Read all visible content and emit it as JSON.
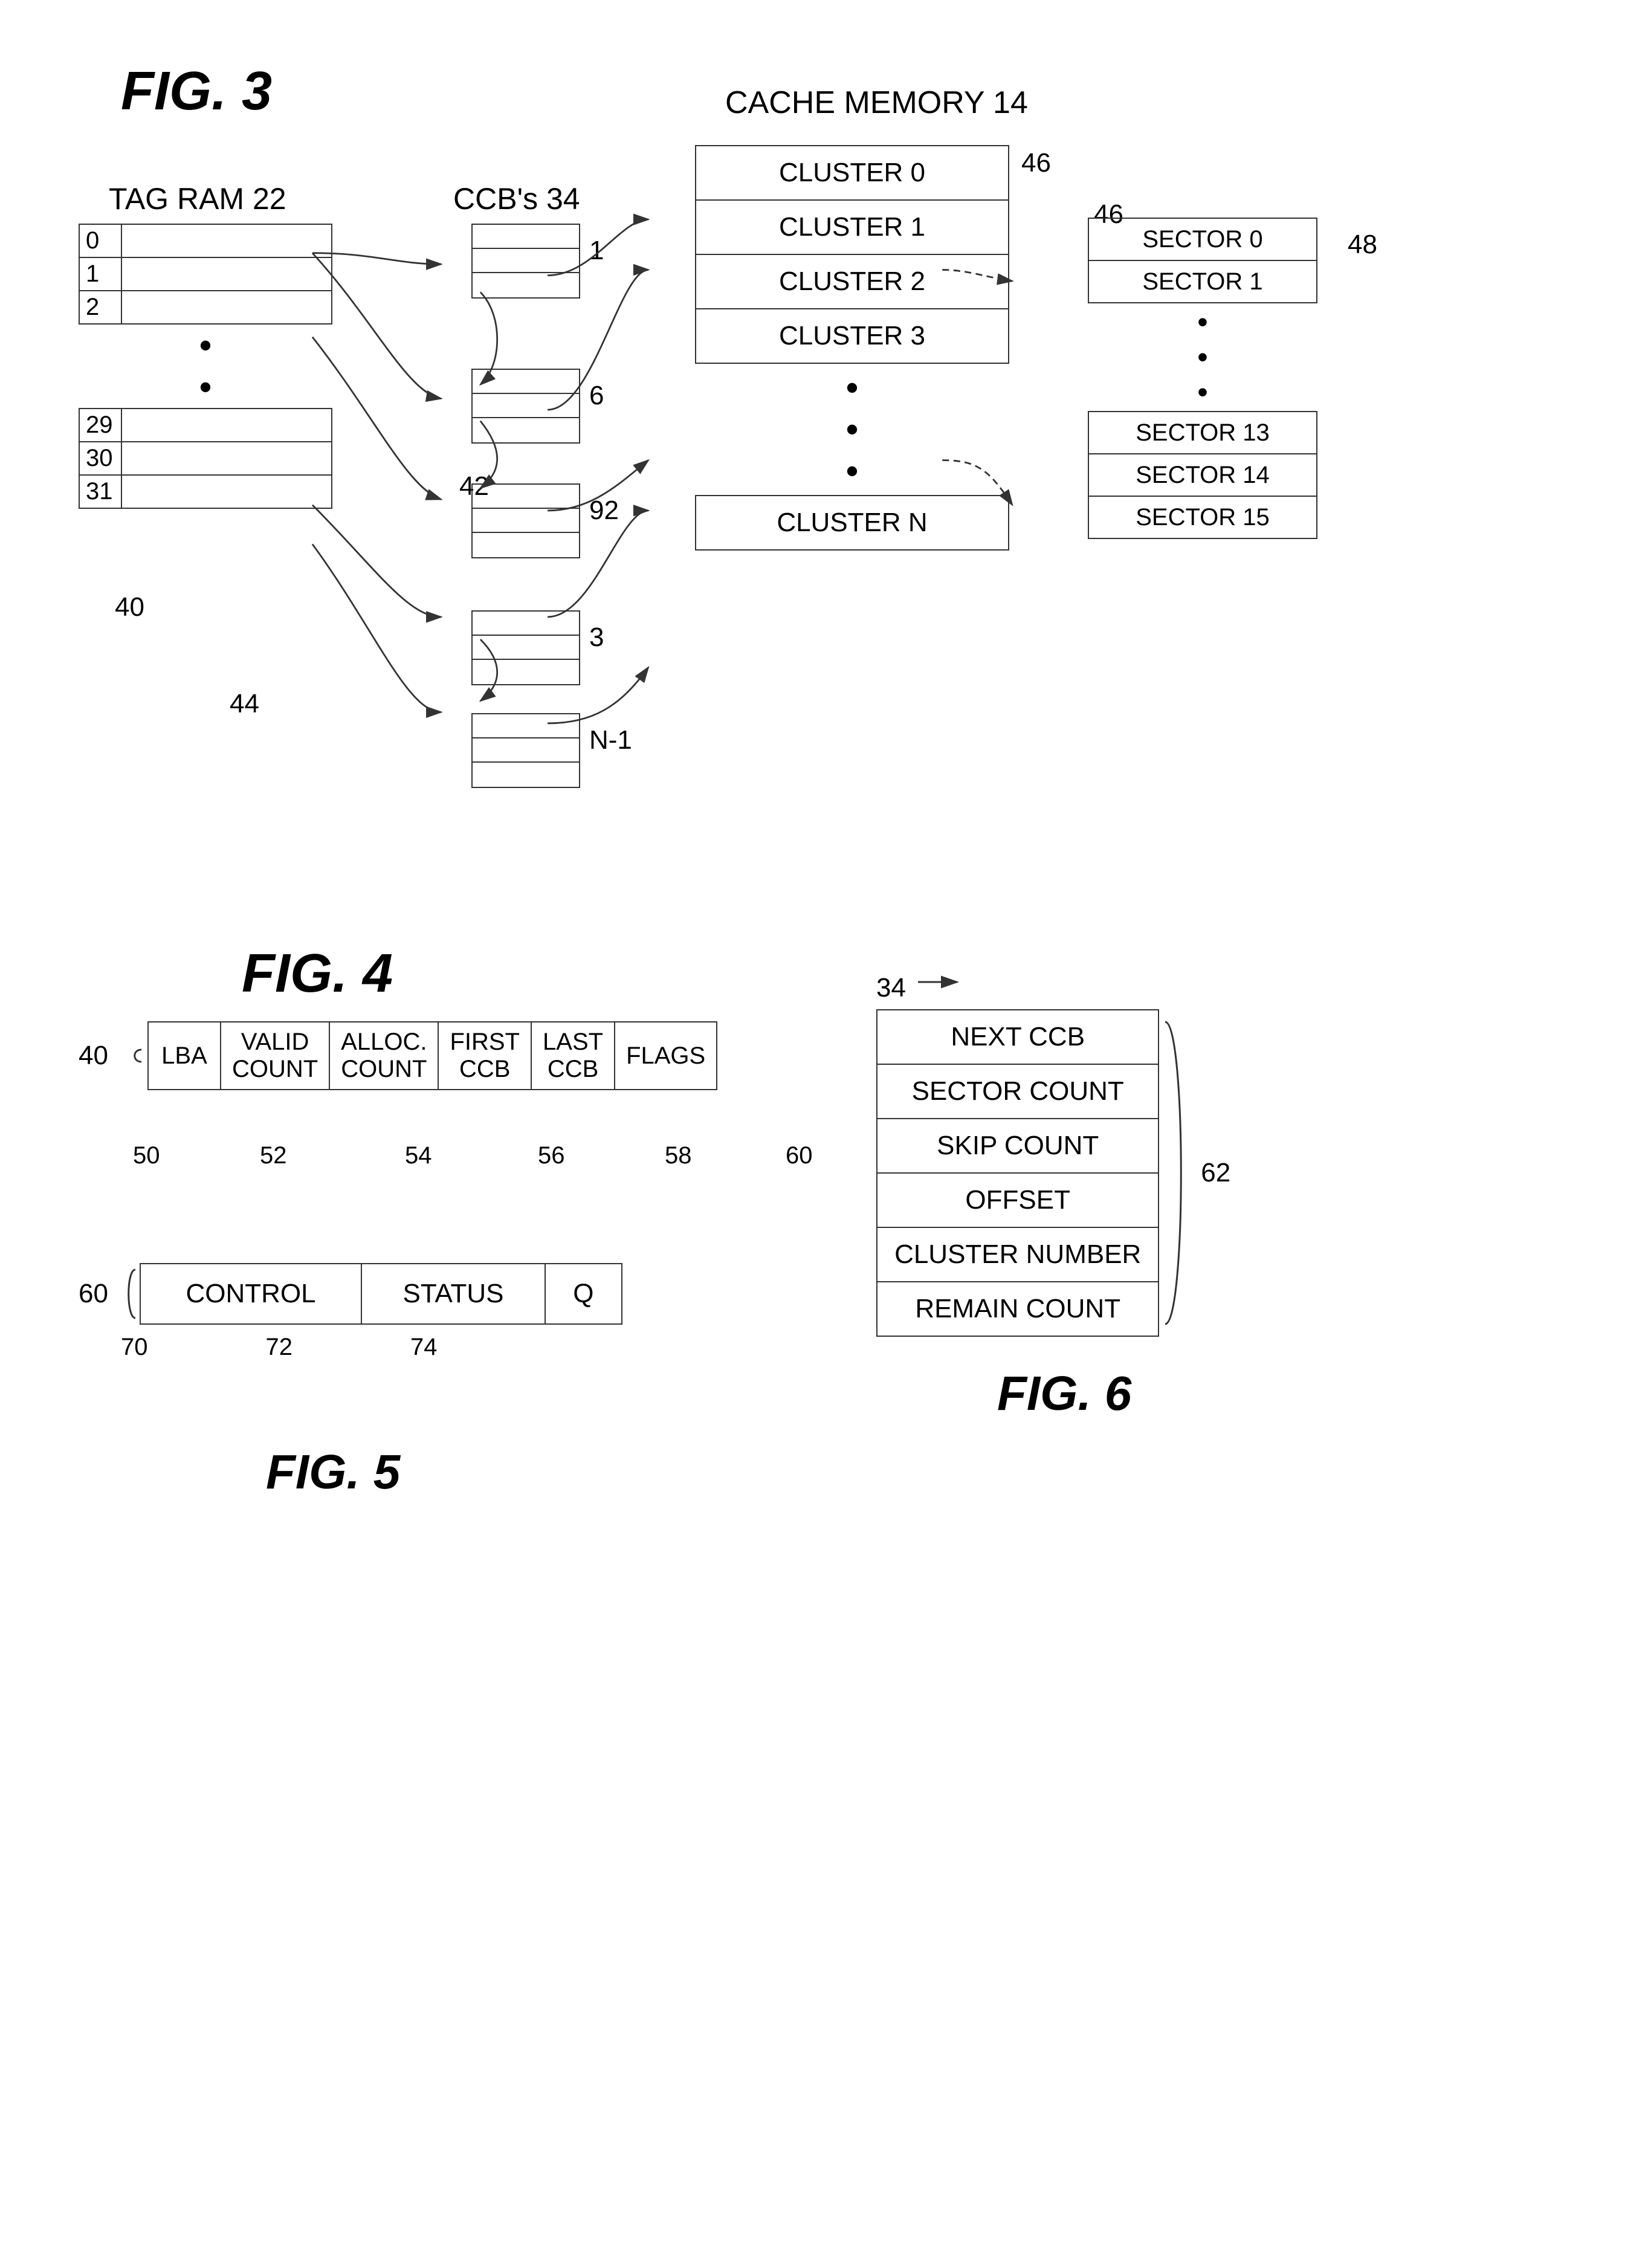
{
  "fig3": {
    "title": "FIG. 3",
    "cache_memory_label": "CACHE MEMORY 14",
    "tag_ram_label": "TAG RAM 22",
    "ccb_label": "CCB's 34",
    "cache_clusters": [
      "CLUSTER 0",
      "CLUSTER 1",
      "CLUSTER 2",
      "CLUSTER 3",
      ".",
      ".",
      ".",
      "CLUSTER N"
    ],
    "sectors": [
      "SECTOR 0",
      "SECTOR 1",
      ".",
      ".",
      ".",
      "SECTOR 13",
      "SECTOR 14",
      "SECTOR 15"
    ],
    "tag_ram_rows": [
      "0",
      "1",
      "2",
      ".",
      ".",
      "29",
      "30",
      "31"
    ],
    "ccb_groups": [
      {
        "label": "1",
        "rows": 3
      },
      {
        "label": "6",
        "rows": 3
      },
      {
        "label": "92",
        "rows": 3
      },
      {
        "label": "3",
        "rows": 3
      },
      {
        "label": "N-1",
        "rows": 3
      }
    ],
    "ref_numbers": {
      "r40": "40",
      "r42": "42",
      "r44": "44",
      "r46a": "46",
      "r46b": "46",
      "r48": "48"
    }
  },
  "fig4": {
    "title": "FIG. 4",
    "tag_ram_ref": "40",
    "fields": [
      "LBA",
      "VALID\nCOUNT",
      "ALLOC.\nCOUNT",
      "FIRST\nCCB",
      "LAST\nCCB",
      "FLAGS"
    ],
    "field_refs": [
      "50",
      "52",
      "54",
      "56",
      "58",
      "60"
    ]
  },
  "fig5": {
    "title": "FIG. 5",
    "fields": [
      "CONTROL",
      "STATUS",
      "Q"
    ],
    "ref_label": "60",
    "ref_numbers": [
      "70",
      "72",
      "74"
    ]
  },
  "fig6": {
    "title": "FIG. 6",
    "ref_label": "34",
    "fields": [
      "NEXT CCB",
      "SECTOR COUNT",
      "SKIP COUNT",
      "OFFSET",
      "CLUSTER NUMBER",
      "REMAIN COUNT"
    ],
    "ref_number": "62"
  }
}
